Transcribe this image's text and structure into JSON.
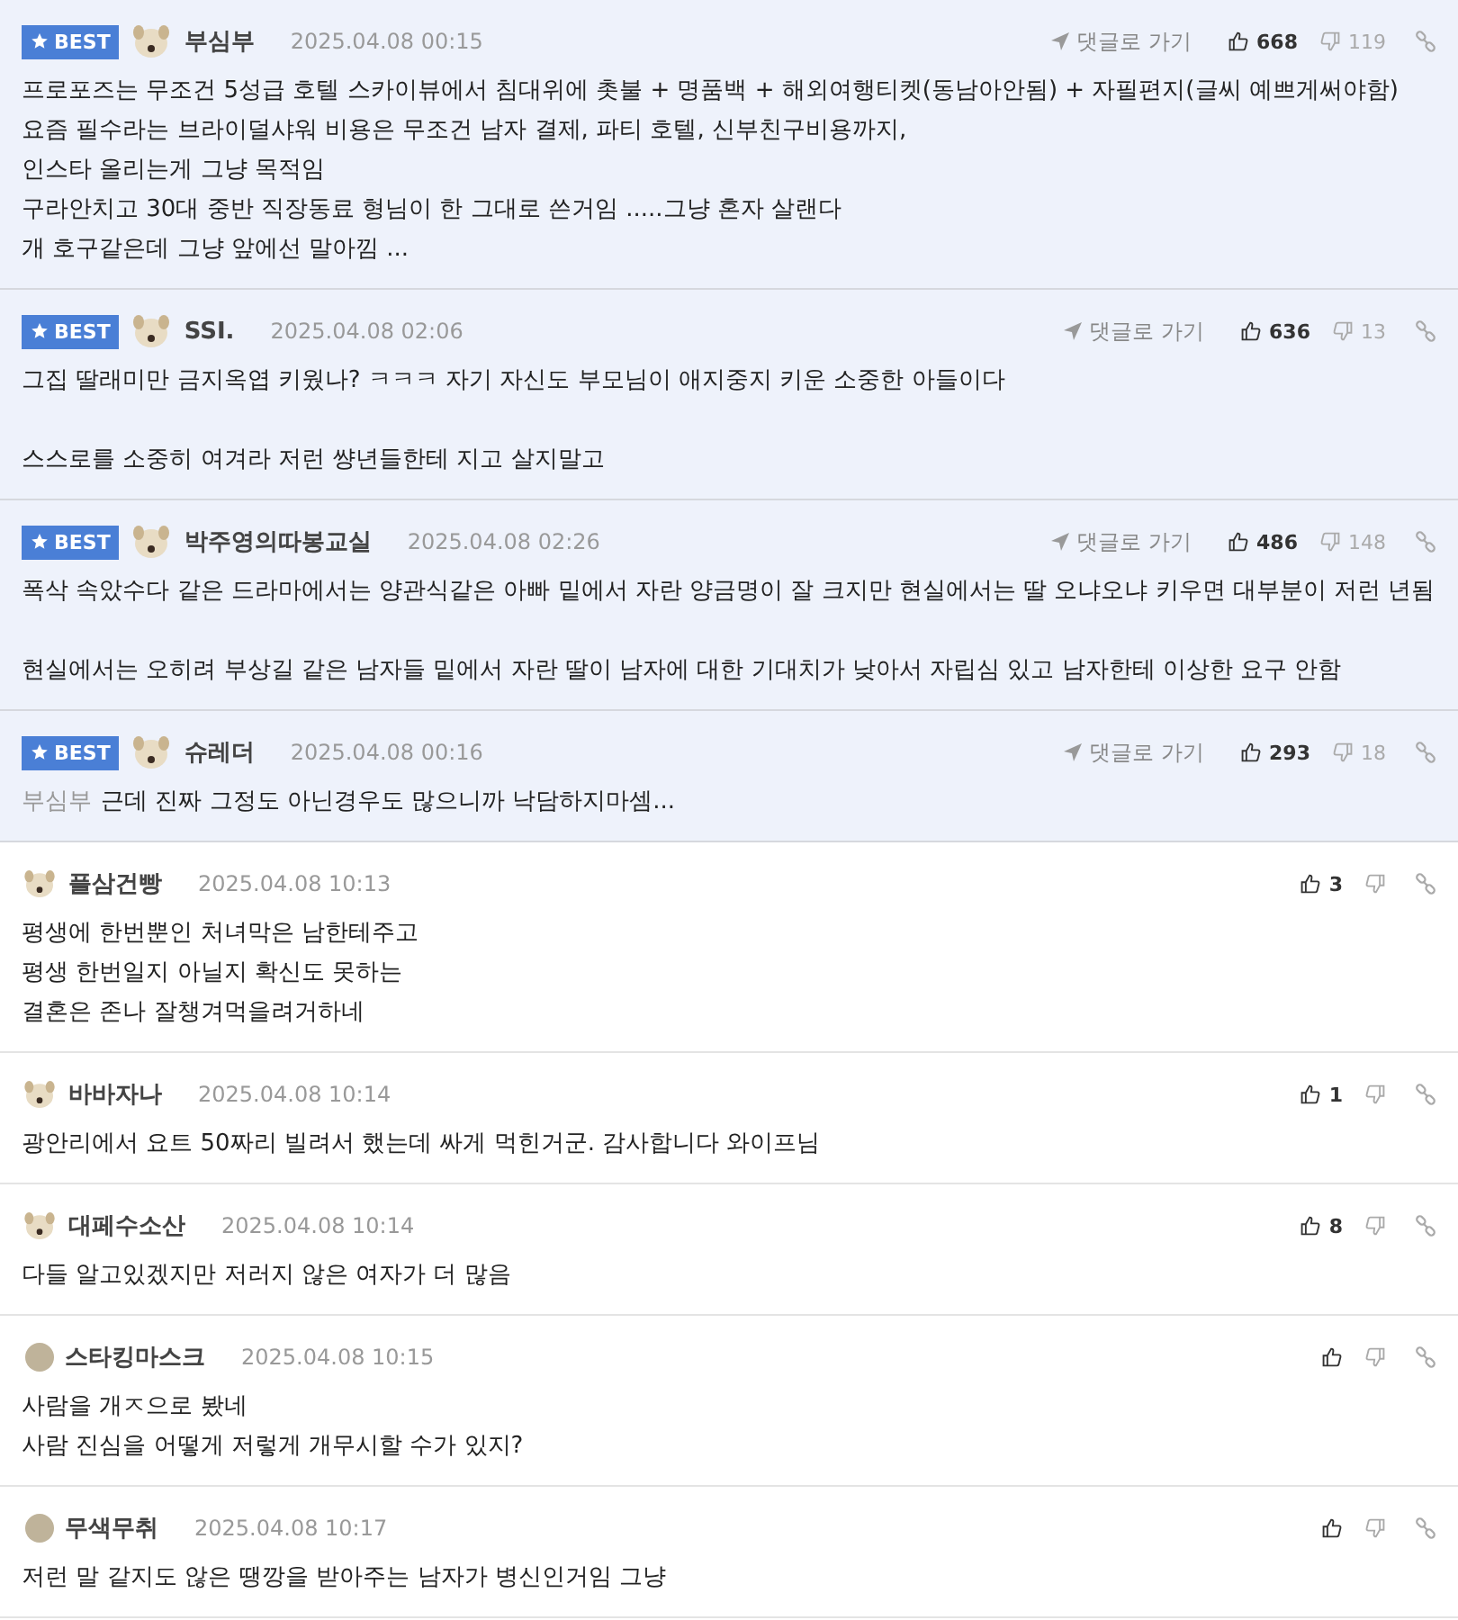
{
  "comments": [
    {
      "best": true,
      "badge": "BEST",
      "kind": "picture",
      "author": "부심부",
      "date": "2025.04.08 00:15",
      "goto": "댓글로 가기",
      "likes": "668",
      "dislikes": "119",
      "paragraphs": [
        [
          "프로포즈는 무조건 5성급 호텔 스카이뷰에서 침대위에 촛불 + 명품백 + 해외여행티켓(동남아안됨) + 자필편지(글씨 예쁘게써야함)",
          "요즘 필수라는 브라이덜샤워 비용은 무조건 남자 결제, 파티 호텔, 신부친구비용까지,",
          "인스타 올리는게 그냥 목적임",
          "구라안치고 30대 중반 직장동료 형님이 한 그대로 쓴거임 .....그냥 혼자 살랜다",
          "개 호구같은데 그냥 앞에선 말아낌 ..."
        ]
      ]
    },
    {
      "best": true,
      "badge": "BEST",
      "kind": "picture",
      "author": "SSI.",
      "date": "2025.04.08 02:06",
      "goto": "댓글로 가기",
      "likes": "636",
      "dislikes": "13",
      "paragraphs": [
        [
          "그집 딸래미만 금지옥엽 키웠나? ㅋㅋㅋ 자기 자신도 부모님이 애지중지 키운 소중한 아들이다"
        ],
        [
          "스스로를 소중히 여겨라 저런 썅년들한테 지고 살지말고"
        ]
      ]
    },
    {
      "best": true,
      "badge": "BEST",
      "kind": "picture",
      "author": "박주영의따봉교실",
      "date": "2025.04.08 02:26",
      "goto": "댓글로 가기",
      "likes": "486",
      "dislikes": "148",
      "paragraphs": [
        [
          "폭삭 속았수다 같은 드라마에서는 양관식같은 아빠 밑에서 자란 양금명이 잘 크지만 현실에서는 딸 오냐오냐 키우면 대부분이 저런 년됨"
        ],
        [
          "현실에서는 오히려 부상길 같은 남자들 밑에서 자란 딸이 남자에 대한 기대치가 낮아서 자립심 있고 남자한테 이상한 요구 안함"
        ]
      ]
    },
    {
      "best": true,
      "badge": "BEST",
      "kind": "picture",
      "author": "슈레더",
      "date": "2025.04.08 00:16",
      "goto": "댓글로 가기",
      "likes": "293",
      "dislikes": "18",
      "reply_to": "부심부",
      "paragraphs": [
        [
          "근데 진짜 그정도 아닌경우도 많으니까 낙담하지마셈..."
        ]
      ]
    },
    {
      "best": false,
      "kind": "picture",
      "author": "플삼건빵",
      "date": "2025.04.08 10:13",
      "likes": "3",
      "paragraphs": [
        [
          "평생에 한번뿐인 처녀막은 남한테주고",
          "평생 한번일지 아닐지 확신도 못하는",
          "결혼은 존나 잘챙겨먹을려거하네"
        ]
      ]
    },
    {
      "best": false,
      "kind": "picture",
      "author": "바바자나",
      "date": "2025.04.08 10:14",
      "likes": "1",
      "paragraphs": [
        [
          "광안리에서 요트 50짜리 빌려서 했는데 싸게 먹힌거군. 감사합니다 와이프님"
        ]
      ]
    },
    {
      "best": false,
      "kind": "picture",
      "author": "대페수소산",
      "date": "2025.04.08 10:14",
      "likes": "8",
      "paragraphs": [
        [
          "다들 알고있겠지만 저러지 않은 여자가 더 많음"
        ]
      ]
    },
    {
      "best": false,
      "kind": "dot",
      "author": "스타킹마스크",
      "date": "2025.04.08 10:15",
      "paragraphs": [
        [
          "사람을 개ㅈ으로 봤네",
          "사람 진심을 어떻게 저렇게 개무시할 수가 있지?"
        ]
      ]
    },
    {
      "best": false,
      "kind": "dot",
      "author": "무색무취",
      "date": "2025.04.08 10:17",
      "paragraphs": [
        [
          "저런 말 같지도 않은 땡깡을 받아주는 남자가 병신인거임 그냥"
        ]
      ]
    }
  ]
}
